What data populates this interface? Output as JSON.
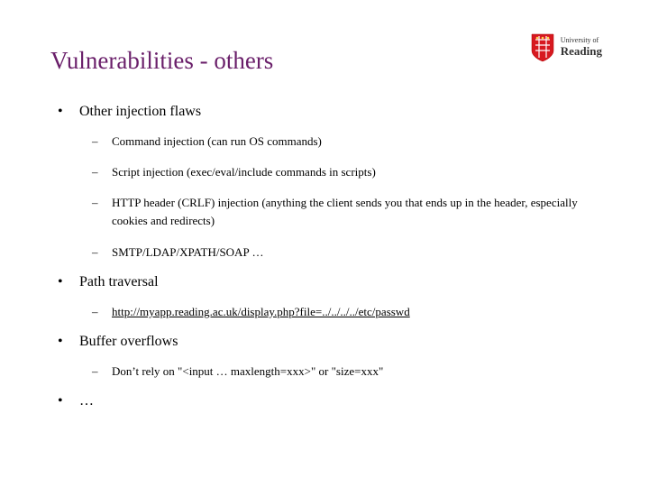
{
  "logo": {
    "line1": "University of",
    "line2": "Reading"
  },
  "title": "Vulnerabilities - others",
  "bullets": [
    {
      "text": "Other injection flaws",
      "sub": [
        "Command injection (can run OS commands)",
        "Script injection (exec/eval/include commands in scripts)",
        "HTTP header (CRLF) injection (anything the client sends you that ends up in the header, especially cookies and redirects)",
        "SMTP/LDAP/XPATH/SOAP …"
      ]
    },
    {
      "text": "Path traversal",
      "sub_link": [
        "http://myapp.reading.ac.uk/display.php?file=../../../../etc/passwd"
      ]
    },
    {
      "text": "Buffer overflows",
      "sub": [
        "Don’t rely on \"<input … maxlength=xxx>\" or \"size=xxx\""
      ]
    },
    {
      "text": "…"
    }
  ]
}
